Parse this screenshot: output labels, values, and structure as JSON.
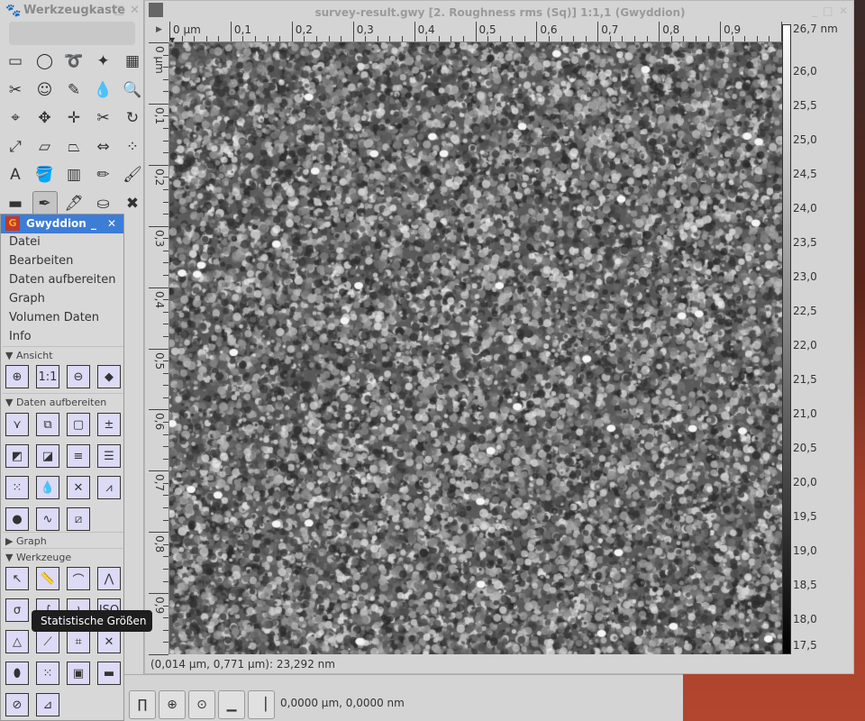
{
  "toolbox": {
    "title": "Werkzeugkaste",
    "tools": [
      "rect-select",
      "ellipse-select",
      "lasso",
      "fuzzy-select",
      "color-select",
      "scissors",
      "foreground-select",
      "paths",
      "color-picker",
      "zoom",
      "measure",
      "move",
      "align",
      "crop",
      "rotate",
      "scale",
      "shear",
      "perspective",
      "flip",
      "cage",
      "text",
      "bucket-fill",
      "blend",
      "pencil",
      "paintbrush",
      "eraser",
      "airbrush",
      "ink",
      "clone",
      "heal"
    ],
    "glyphs": [
      "▭",
      "◯",
      "➰",
      "✦",
      "▦",
      "✂",
      "☺",
      "✎",
      "💧",
      "🔍",
      "⌖",
      "✥",
      "✛",
      "✂",
      "↻",
      "⤢",
      "▱",
      "⏢",
      "⇔",
      "⁘",
      "A",
      "🪣",
      "▥",
      "✏",
      "🖌",
      "▬",
      "✒",
      "🖋",
      "⛀",
      "✖"
    ]
  },
  "data_window": {
    "title": "survey-result.gwy [2. Roughness rms (Sq)] 1:1,1 (Gwyddion)",
    "x_ruler": [
      "0 µm",
      "0,1",
      "0,2",
      "0,3",
      "0,4",
      "0,5",
      "0,6",
      "0,7",
      "0,8",
      "0,9"
    ],
    "y_ruler": [
      "0 µm",
      "0,1",
      "0,2",
      "0,3",
      "0,4",
      "0,5",
      "0,6",
      "0,7",
      "0,8",
      "0,9"
    ],
    "colorbar": {
      "max": "26,7 nm",
      "labels": [
        "26,0",
        "25,5",
        "25,0",
        "24,5",
        "24,0",
        "23,5",
        "23,0",
        "22,5",
        "22,0",
        "21,5",
        "21,0",
        "20,5",
        "20,0",
        "19,5",
        "19,0",
        "18,5",
        "18,0",
        "17,5"
      ]
    },
    "status": "(0,014 µm, 0,771 µm): 23,292 nm"
  },
  "gwyddion": {
    "title": "Gwyddion",
    "menu": [
      "Datei",
      "Bearbeiten",
      "Daten aufbereiten",
      "Graph",
      "Volumen Daten",
      "Info"
    ],
    "sections": {
      "view": "Ansicht",
      "process": "Daten aufbereiten",
      "graph": "Graph",
      "tools": "Werkzeuge"
    },
    "view_icons": [
      "⊕",
      "1:1",
      "⊖",
      "◆"
    ],
    "process_icons": [
      "⋎",
      "⧉",
      "▢",
      "±",
      "◩",
      "◪",
      "≡",
      "☰",
      "⁙",
      "💧",
      "✕",
      "⩘",
      "●",
      "∿",
      "⧄"
    ],
    "tool_icons": [
      "↖",
      "📏",
      "⌒",
      "⋀",
      "σ",
      "∫",
      "≀",
      "ISO",
      "△",
      "⟋",
      "⌗",
      "✕",
      "⬮",
      "⁙",
      "▣",
      "▬",
      "⊘",
      "⊿"
    ],
    "tooltip": "Statistische Größen"
  },
  "bottom_window": {
    "icons": [
      "∏",
      "⊕",
      "⊙",
      "▁",
      "▕"
    ],
    "readout": "0,0000 µm, 0,0000 nm"
  }
}
